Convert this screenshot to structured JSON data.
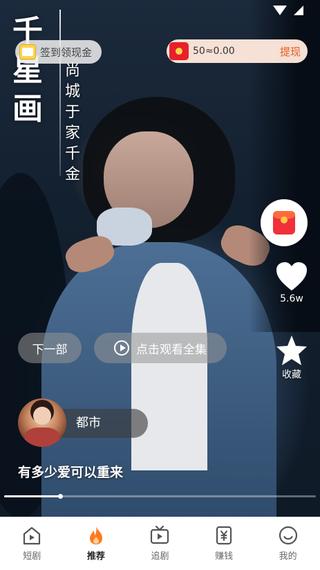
{
  "logo": {
    "main": "千星画",
    "sub": "尚城于家千金"
  },
  "signin": {
    "label": "签到领现金",
    "icon": "calendar-icon"
  },
  "cash": {
    "icon": "red-packet-icon",
    "amount": "50≈0.00",
    "withdraw": "提现"
  },
  "actions": {
    "red_packet_icon": "red-envelope-icon",
    "like": {
      "icon": "heart-icon",
      "count": "5.6w"
    },
    "favorite": {
      "icon": "star-icon",
      "label": "收藏"
    }
  },
  "buttons": {
    "next": "下一部",
    "watch_all": "点击观看全集",
    "watch_icon": "play-circle-icon"
  },
  "channel": {
    "tag": "都市"
  },
  "episode": {
    "title": "有多少爱可以重来"
  },
  "progress": {
    "fraction": 0.18
  },
  "tabbar": {
    "items": [
      {
        "label": "短剧",
        "icon": "home-play-icon",
        "active": false
      },
      {
        "label": "推荐",
        "icon": "flame-icon",
        "active": true
      },
      {
        "label": "追剧",
        "icon": "tv-icon",
        "active": false
      },
      {
        "label": "赚钱",
        "icon": "yuan-wallet-icon",
        "active": false
      },
      {
        "label": "我的",
        "icon": "smile-icon",
        "active": false
      }
    ]
  },
  "colors": {
    "accent": "#ff7a1a",
    "withdraw": "#e85b1c",
    "red_packet": "#f0303a"
  }
}
